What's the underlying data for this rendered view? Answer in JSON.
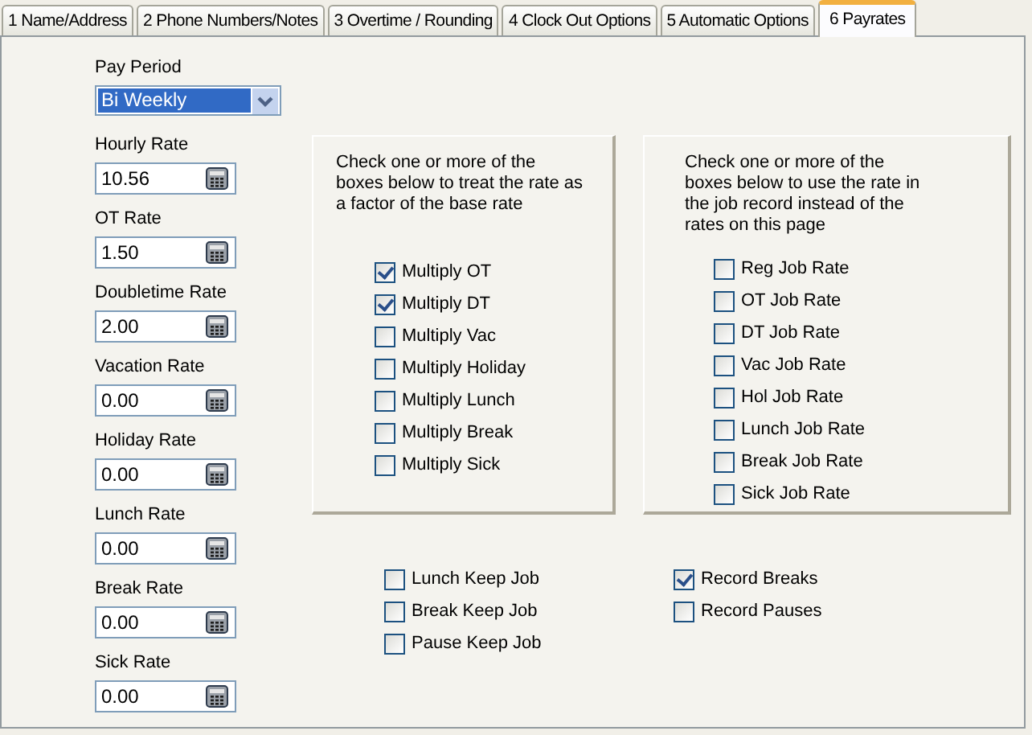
{
  "tabs": [
    {
      "label": "1 Name/Address",
      "selected": false
    },
    {
      "label": "2 Phone Numbers/Notes",
      "selected": false
    },
    {
      "label": "3 Overtime / Rounding",
      "selected": false
    },
    {
      "label": "4 Clock Out Options",
      "selected": false
    },
    {
      "label": "5 Automatic Options",
      "selected": false
    },
    {
      "label": "6 Payrates",
      "selected": true
    }
  ],
  "pay_period": {
    "label": "Pay Period",
    "value": "Bi Weekly"
  },
  "rates": [
    {
      "label": "Hourly Rate",
      "value": "10.56"
    },
    {
      "label": "OT Rate",
      "value": "1.50"
    },
    {
      "label": "Doubletime Rate",
      "value": "2.00"
    },
    {
      "label": "Vacation Rate",
      "value": "0.00"
    },
    {
      "label": "Holiday Rate",
      "value": "0.00"
    },
    {
      "label": "Lunch Rate",
      "value": "0.00"
    },
    {
      "label": "Break Rate",
      "value": "0.00"
    },
    {
      "label": "Sick Rate",
      "value": "0.00"
    }
  ],
  "factor_group": {
    "text": "Check one or more of the boxes below to treat the rate as a factor of the base rate",
    "items": [
      {
        "label": "Multiply OT",
        "checked": true
      },
      {
        "label": "Multiply DT",
        "checked": true
      },
      {
        "label": "Multiply Vac",
        "checked": false
      },
      {
        "label": "Multiply Holiday",
        "checked": false
      },
      {
        "label": "Multiply Lunch",
        "checked": false
      },
      {
        "label": "Multiply Break",
        "checked": false
      },
      {
        "label": "Multiply Sick",
        "checked": false
      }
    ]
  },
  "job_group": {
    "text": "Check one or more of the boxes below to use the rate in the job record instead of the rates on this page",
    "items": [
      {
        "label": "Reg Job Rate",
        "checked": false
      },
      {
        "label": "OT Job Rate",
        "checked": false
      },
      {
        "label": "DT Job Rate",
        "checked": false
      },
      {
        "label": "Vac Job Rate",
        "checked": false
      },
      {
        "label": "Hol Job Rate",
        "checked": false
      },
      {
        "label": "Lunch Job Rate",
        "checked": false
      },
      {
        "label": "Break Job Rate",
        "checked": false
      },
      {
        "label": "Sick Job Rate",
        "checked": false
      }
    ]
  },
  "keep_job": [
    {
      "label": "Lunch Keep Job",
      "checked": false
    },
    {
      "label": "Break Keep Job",
      "checked": false
    },
    {
      "label": "Pause Keep Job",
      "checked": false
    }
  ],
  "record": [
    {
      "label": "Record Breaks",
      "checked": true
    },
    {
      "label": "Record Pauses",
      "checked": false
    }
  ]
}
